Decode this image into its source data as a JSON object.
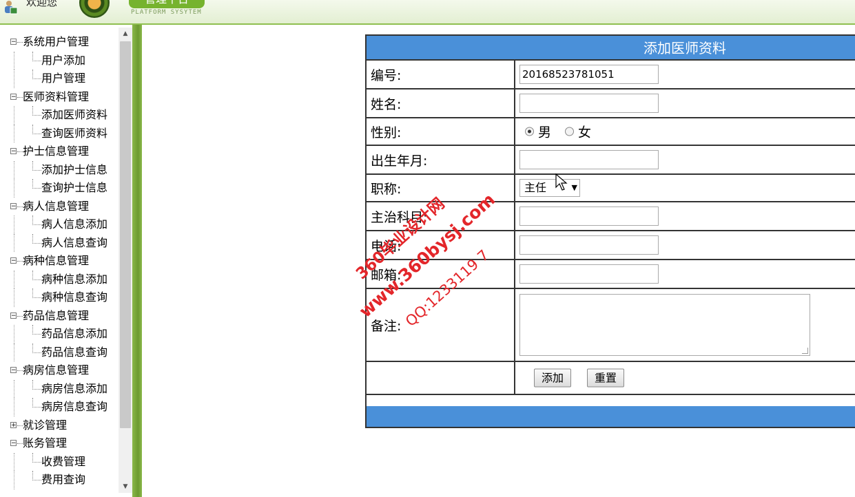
{
  "header": {
    "welcome": "欢迎您",
    "logo_title": "管理平台",
    "logo_subtitle": "PLATFORM SYSYTEM"
  },
  "sidebar": {
    "groups": [
      {
        "label": "系统用户管理",
        "items": [
          "用户添加",
          "用户管理"
        ]
      },
      {
        "label": "医师资料管理",
        "items": [
          "添加医师资料",
          "查询医师资料"
        ]
      },
      {
        "label": "护士信息管理",
        "items": [
          "添加护士信息",
          "查询护士信息"
        ]
      },
      {
        "label": "病人信息管理",
        "items": [
          "病人信息添加",
          "病人信息查询"
        ]
      },
      {
        "label": "病种信息管理",
        "items": [
          "病种信息添加",
          "病种信息查询"
        ]
      },
      {
        "label": "药品信息管理",
        "items": [
          "药品信息添加",
          "药品信息查询"
        ]
      },
      {
        "label": "病房信息管理",
        "items": [
          "病房信息添加",
          "病房信息查询"
        ]
      },
      {
        "label": "就诊管理",
        "collapsed": true,
        "items": []
      },
      {
        "label": "账务管理",
        "items": [
          "收费管理",
          "费用查询"
        ]
      }
    ]
  },
  "form": {
    "title": "添加医师资料",
    "fields": {
      "id": {
        "label": "编号:",
        "value": "20168523781051"
      },
      "name": {
        "label": "姓名:",
        "value": ""
      },
      "gender": {
        "label": "性别:",
        "options": [
          "男",
          "女"
        ],
        "selected": "男"
      },
      "birth": {
        "label": "出生年月:",
        "value": ""
      },
      "title": {
        "label": "职称:",
        "selected": "主任"
      },
      "department": {
        "label": "主治科目:",
        "value": ""
      },
      "phone": {
        "label": "电话:",
        "value": ""
      },
      "email": {
        "label": "邮箱:",
        "value": ""
      },
      "notes": {
        "label": "备注:",
        "value": ""
      }
    },
    "buttons": {
      "add": "添加",
      "reset": "重置"
    }
  },
  "watermark": {
    "line1": "360毕业设计网",
    "line2": "www.360bysj.com",
    "line3": "QQ:1233119 7"
  }
}
